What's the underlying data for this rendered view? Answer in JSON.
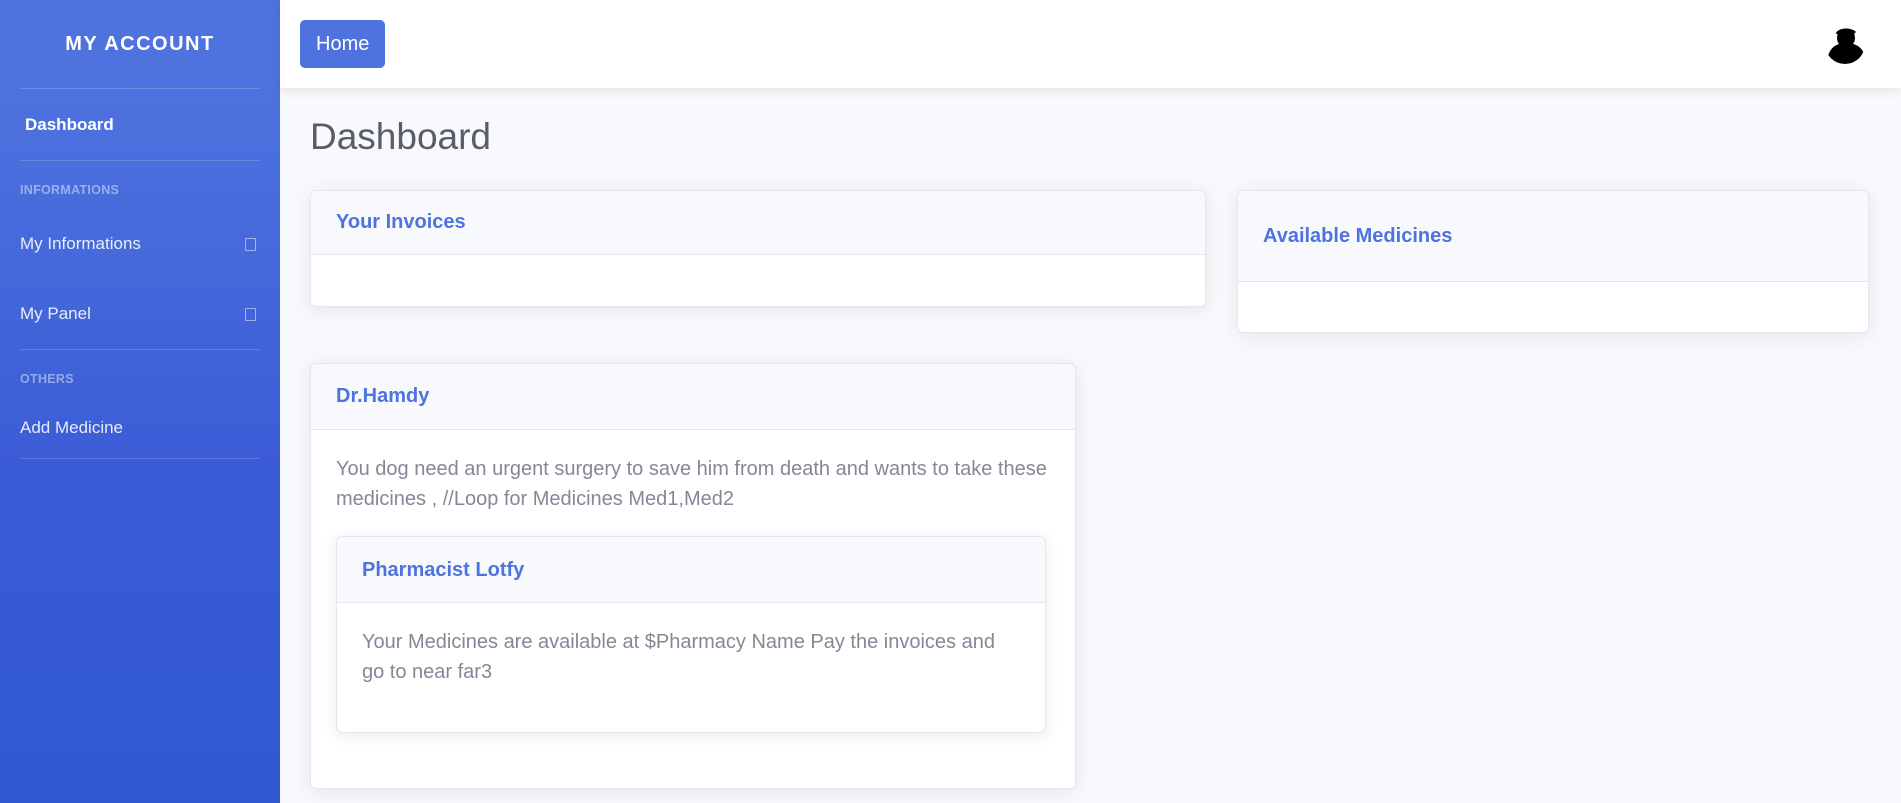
{
  "sidebar": {
    "brand": "MY ACCOUNT",
    "dashboard": "Dashboard",
    "heading_info": "INFORMATIONS",
    "my_informations": "My Informations",
    "my_panel": "My Panel",
    "heading_others": "OTHERS",
    "add_medicine": "Add Medicine"
  },
  "topbar": {
    "home_label": "Home",
    "avatar_icon": "user-avatar-icon"
  },
  "main": {
    "page_title": "Dashboard",
    "invoices_title": "Your Invoices",
    "medicines_title": "Available Medicines",
    "doctor_card": {
      "title": "Dr.Hamdy",
      "text": "You dog need an urgent surgery to save him from death and wants to take these medicines , //Loop for Medicines Med1,Med2",
      "pharmacist": {
        "title": "Pharmacist Lotfy",
        "text": "Your Medicines are available at $Pharmacy Name Pay the invoices and go to near far3"
      }
    }
  },
  "colors": {
    "primary": "#4e73df",
    "text_muted": "#858796",
    "heading": "#5a5c69",
    "background": "#f8f9fc"
  }
}
